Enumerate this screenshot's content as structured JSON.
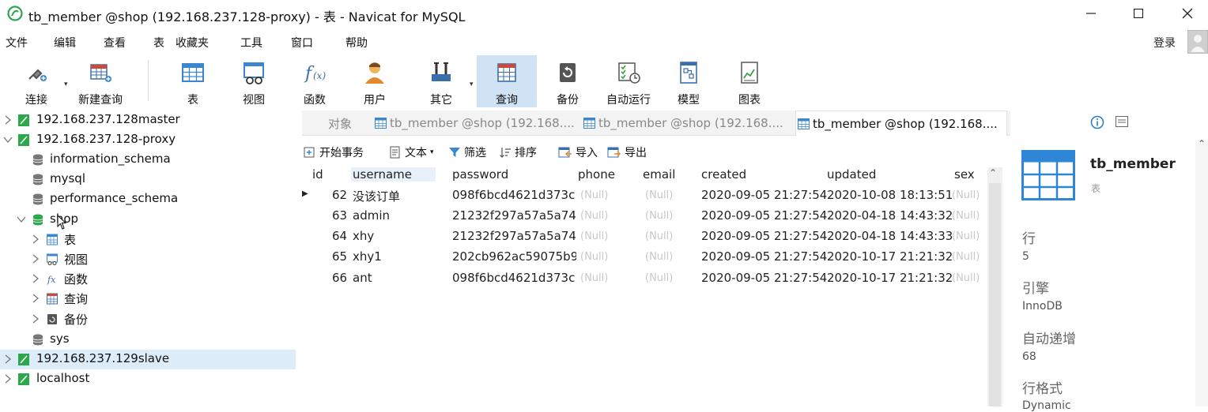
{
  "window": {
    "title": "tb_member @shop (192.168.237.128-proxy) - 表 - Navicat for MySQL",
    "login_label": "登录"
  },
  "menu": [
    "文件",
    "编辑",
    "查看",
    "表",
    "收藏夹",
    "工具",
    "窗口",
    "帮助"
  ],
  "toolbar": {
    "connect": "连接",
    "new_query": "新建查询",
    "table": "表",
    "view": "视图",
    "function": "函数",
    "user": "用户",
    "other": "其它",
    "query": "查询",
    "backup": "备份",
    "automation": "自动运行",
    "model": "模型",
    "chart": "图表",
    "active_tool": "查询"
  },
  "tree": {
    "conn1": "192.168.237.128master",
    "conn2": "192.168.237.128-proxy",
    "db1": "information_schema",
    "db2": "mysql",
    "db3": "performance_schema",
    "db4": "shop",
    "shop_tables": "表",
    "shop_views": "视图",
    "shop_functions": "函数",
    "shop_queries": "查询",
    "shop_backups": "备份",
    "db5": "sys",
    "conn3": "192.168.237.129slave",
    "conn4": "localhost"
  },
  "tabs": {
    "objects": "对象",
    "tab1": "tb_member @shop (192.168....",
    "tab2": "tb_member @shop (192.168....",
    "tab3": "tb_member @shop (192.168...."
  },
  "subtoolbar": {
    "begin_tx": "开始事务",
    "text": "文本",
    "filter": "筛选",
    "sort": "排序",
    "import": "导入",
    "export": "导出"
  },
  "grid": {
    "columns": [
      "id",
      "username",
      "password",
      "phone",
      "email",
      "created",
      "updated",
      "sex"
    ],
    "null_text": "(Null)",
    "rows": [
      {
        "id": "62",
        "username": "没该订单",
        "password": "098f6bcd4621d373c",
        "created": "2020-09-05 21:27:54",
        "updated": "2020-10-08 18:13:51"
      },
      {
        "id": "63",
        "username": "admin",
        "password": "21232f297a57a5a74.",
        "created": "2020-09-05 21:27:54",
        "updated": "2020-04-18 14:43:32"
      },
      {
        "id": "64",
        "username": "xhy",
        "password": "21232f297a57a5a74.",
        "created": "2020-09-05 21:27:54",
        "updated": "2020-04-18 14:43:33"
      },
      {
        "id": "65",
        "username": "xhy1",
        "password": "202cb962ac59075b9",
        "created": "2020-09-05 21:27:54",
        "updated": "2020-10-17 21:21:32"
      },
      {
        "id": "66",
        "username": "ant",
        "password": "098f6bcd4621d373c",
        "created": "2020-09-05 21:27:54",
        "updated": "2020-10-17 21:21:32"
      }
    ]
  },
  "info": {
    "table_name": "tb_member",
    "table_sub": "表",
    "rows_label": "行",
    "rows_value": "5",
    "engine_label": "引擎",
    "engine_value": "InnoDB",
    "autoinc_label": "自动递增",
    "autoinc_value": "68",
    "row_format_label": "行格式",
    "row_format_value": "Dynamic"
  },
  "colors": {
    "accent": "#2a7ac4",
    "tree_selected": "#dcecf8",
    "active_tool": "#cfe3f5",
    "connection_green": "#2aa84a"
  }
}
